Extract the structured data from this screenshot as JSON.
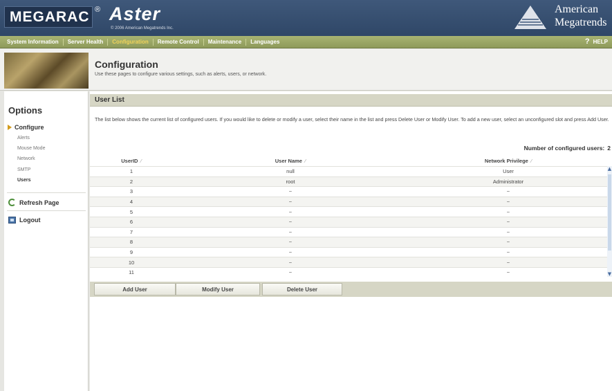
{
  "header": {
    "logo": "MEGARAC",
    "registered": "®",
    "product": "Aster",
    "copyright": "© 2006 American Megatrends Inc.",
    "vendor_line1": "American",
    "vendor_line2": "Megatrends"
  },
  "nav": {
    "items": [
      {
        "label": "System Information"
      },
      {
        "label": "Server Health"
      },
      {
        "label": "Configuration"
      },
      {
        "label": "Remote Control"
      },
      {
        "label": "Maintenance"
      },
      {
        "label": "Languages"
      }
    ],
    "active_index": 2,
    "help_icon": "?",
    "help_label": "HELP"
  },
  "banner": {
    "title": "Configuration",
    "subtitle": "Use these pages to configure various settings, such as alerts, users, or network."
  },
  "sidebar": {
    "title": "Options",
    "configure_label": "Configure",
    "sub_items": [
      {
        "label": "Alerts"
      },
      {
        "label": "Mouse Mode"
      },
      {
        "label": "Network"
      },
      {
        "label": "SMTP"
      },
      {
        "label": "Users"
      }
    ],
    "active_sub": "Users",
    "refresh_label": "Refresh Page",
    "logout_label": "Logout"
  },
  "main": {
    "section_title": "User List",
    "description": "The list below shows the current list of configured users. If you would like to delete or modify a user, select their name in the list and press Delete User or Modify User. To add a new user, select an unconfigured slot and press Add User.",
    "count_label": "Number of configured users:",
    "count_value": "2",
    "columns": [
      "UserID",
      "User Name",
      "Network Privilege"
    ],
    "sort_glyph": "⁄",
    "rows": [
      {
        "id": "1",
        "name": "null",
        "privilege": "User"
      },
      {
        "id": "2",
        "name": "root",
        "privilege": "Administrator"
      },
      {
        "id": "3",
        "name": "~",
        "privilege": "~"
      },
      {
        "id": "4",
        "name": "~",
        "privilege": "~"
      },
      {
        "id": "5",
        "name": "~",
        "privilege": "~"
      },
      {
        "id": "6",
        "name": "~",
        "privilege": "~"
      },
      {
        "id": "7",
        "name": "~",
        "privilege": "~"
      },
      {
        "id": "8",
        "name": "~",
        "privilege": "~"
      },
      {
        "id": "9",
        "name": "~",
        "privilege": "~"
      },
      {
        "id": "10",
        "name": "~",
        "privilege": "~"
      },
      {
        "id": "11",
        "name": "~",
        "privilege": "~"
      }
    ],
    "buttons": {
      "add": "Add User",
      "modify": "Modify User",
      "delete": "Delete User"
    }
  },
  "colors": {
    "header_bg": "#3f587a",
    "nav_bg": "#a8b472",
    "nav_active": "#f2d35a",
    "section_bar": "#d6d6c5"
  }
}
